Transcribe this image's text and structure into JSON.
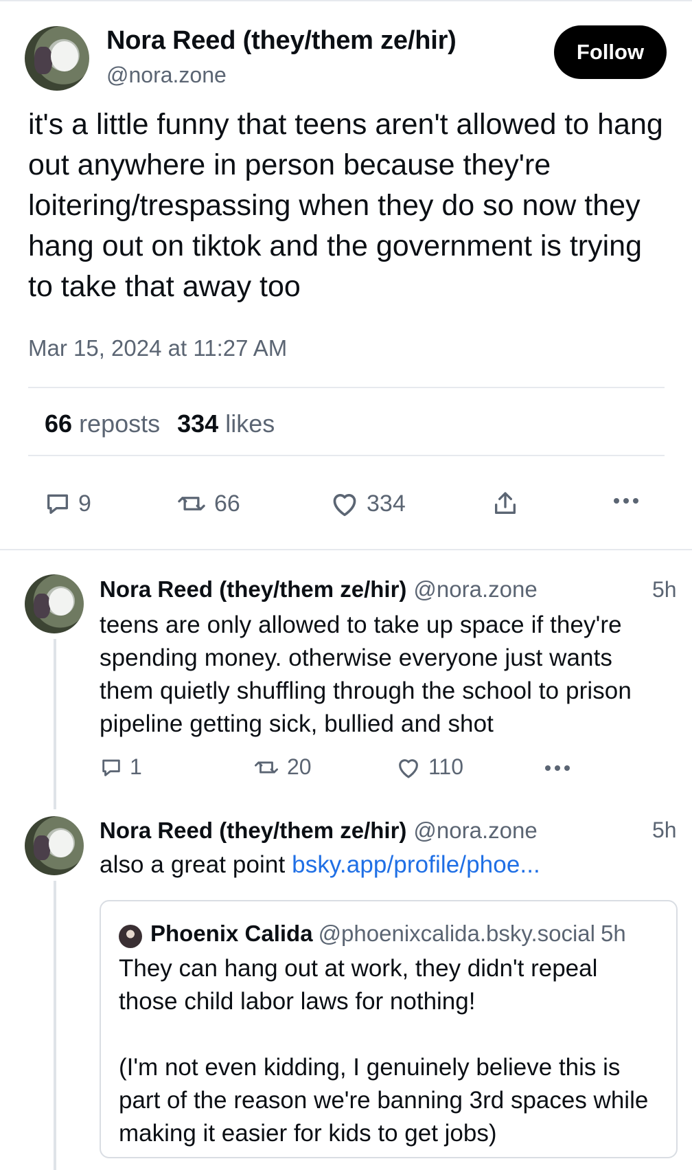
{
  "post": {
    "author_name": "Nora Reed (they/them ze/hir)",
    "handle": "@nora.zone",
    "follow_label": "Follow",
    "text": "it's a little funny that teens aren't allowed to hang out anywhere in person because they're loitering/trespassing when they do so now they hang out on tiktok and the government is trying to take that away too",
    "timestamp": "Mar 15, 2024 at 11:27 AM",
    "reposts_count": "66",
    "reposts_label": "reposts",
    "likes_count": "334",
    "likes_label": "likes",
    "actions": {
      "reply_count": "9",
      "repost_count": "66",
      "like_count": "334"
    }
  },
  "replies": [
    {
      "author_name": "Nora Reed (they/them ze/hir)",
      "handle": "@nora.zone",
      "time": "5h",
      "text": "teens are only allowed to take up space if they're spending money. otherwise everyone just wants them quietly shuffling through the school to prison pipeline getting sick, bullied and shot",
      "reply_count": "1",
      "repost_count": "20",
      "like_count": "110"
    },
    {
      "author_name": "Nora Reed (they/them ze/hir)",
      "handle": "@nora.zone",
      "time": "5h",
      "text": "also a great point",
      "link": "bsky.app/profile/phoe...",
      "quote": {
        "author_name": "Phoenix Calida",
        "handle": "@phoenixcalida.bsky.social",
        "time": "5h",
        "text": "They can hang out at work, they didn't repeal those child labor laws for nothing!\n\n(I'm not even kidding, I genuinely believe this is part of the reason we're banning 3rd spaces while making it easier for kids to get jobs)"
      }
    }
  ],
  "icons": [
    "reply-icon",
    "repost-icon",
    "like-icon",
    "share-icon",
    "more-icon"
  ],
  "colors": {
    "link": "#1f6fe5",
    "muted": "#5b6573",
    "follow_bg": "#000000"
  }
}
